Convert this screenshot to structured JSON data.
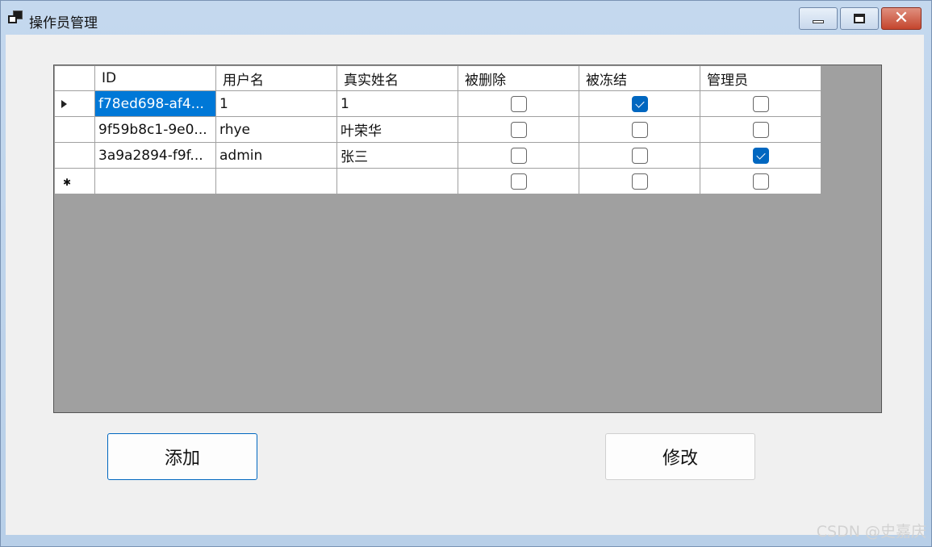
{
  "window": {
    "title": "操作员管理",
    "colors": {
      "selection": "#0078d7",
      "checked": "#0067c0",
      "grid_background": "#a0a0a0"
    }
  },
  "grid": {
    "columns": [
      "ID",
      "用户名",
      "真实姓名",
      "被删除",
      "被冻结",
      "管理员"
    ],
    "rows": [
      {
        "indicator": "current",
        "id": "f78ed698-af4...",
        "username": "1",
        "realname": "1",
        "deleted": false,
        "frozen": true,
        "admin": false
      },
      {
        "indicator": "",
        "id": "9f59b8c1-9e0...",
        "username": "rhye",
        "realname": "叶荣华",
        "deleted": false,
        "frozen": false,
        "admin": false
      },
      {
        "indicator": "",
        "id": "3a9a2894-f9f...",
        "username": "admin",
        "realname": "张三",
        "deleted": false,
        "frozen": false,
        "admin": true
      },
      {
        "indicator": "new",
        "id": "",
        "username": "",
        "realname": "",
        "deleted": false,
        "frozen": false,
        "admin": false
      }
    ]
  },
  "buttons": {
    "add": "添加",
    "edit": "修改"
  },
  "watermark": "CSDN @史嘉庆"
}
